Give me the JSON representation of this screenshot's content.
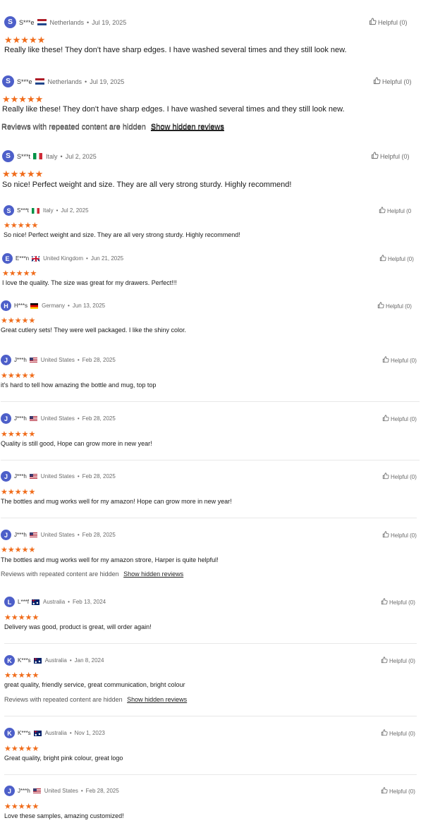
{
  "helpful_label": "Helpful",
  "hidden_note": "Reviews with repeated content are hidden",
  "show_hidden_link": "Show hidden reviews",
  "star_color": "#f06c1b",
  "avatar_color": "#4d5fc9",
  "reviews": [
    {
      "initial": "S",
      "name": "S***e",
      "flag": "nl",
      "country": "Netherlands",
      "date": "Jul 19, 2025",
      "rating": 5,
      "stars": "★★★★★",
      "text": "Really like these! They don't have sharp edges. I have washed several times and they still look new.",
      "helpful": "(0)",
      "helpful_icon": "thumbs-up-icon"
    },
    {
      "initial": "S",
      "name": "S***e",
      "flag": "nl",
      "country": "Netherlands",
      "date": "Jul 19, 2025",
      "rating": 5,
      "stars": "★★★★★",
      "text": "Really like these! They don't have sharp edges. I have washed several times and they still look new.",
      "helpful": "(0)",
      "helpful_icon": "thumbs-up-icon"
    },
    {
      "initial": "S",
      "name": "S***t",
      "flag": "it",
      "country": "Italy",
      "date": "Jul 2, 2025",
      "rating": 5,
      "stars": "★★★★★",
      "text": "So nice! Perfect weight and size. They are all very strong sturdy. Highly recommend!",
      "helpful": "(0)",
      "helpful_icon": "thumbs-up-icon"
    },
    {
      "initial": "S",
      "name": "S***t",
      "flag": "it",
      "country": "Italy",
      "date": "Jul 2, 2025",
      "rating": 5,
      "stars": "★★★★★",
      "text": "So nice! Perfect weight and size. They are all very strong sturdy. Highly recommend!",
      "helpful": "(0",
      "helpful_icon": "thumbs-up-icon"
    },
    {
      "initial": "E",
      "name": "E***n",
      "flag": "uk",
      "country": "United Kingdom",
      "date": "Jun 21, 2025",
      "rating": 5,
      "stars": "★★★★★",
      "text": "I love the quality. The size was great for my drawers. Perfect!!!",
      "helpful": "(0)",
      "helpful_icon": "thumbs-up-icon"
    },
    {
      "initial": "H",
      "name": "H***s",
      "flag": "de",
      "country": "Germany",
      "date": "Jun 13, 2025",
      "rating": 5,
      "stars": "★★★★★",
      "text": "Great cutlery sets! They were well packaged. I like the shiny color.",
      "helpful": "(0)",
      "helpful_icon": "thumbs-up-icon"
    },
    {
      "initial": "J",
      "name": "J***h",
      "flag": "us",
      "country": "United States",
      "date": "Feb 28, 2025",
      "rating": 5,
      "stars": "★★★★★",
      "text": "it's hard to tell how amazing the bottle and mug, top top",
      "helpful": "(0)",
      "helpful_icon": "thumbs-up-icon"
    },
    {
      "initial": "J",
      "name": "J***h",
      "flag": "us",
      "country": "United States",
      "date": "Feb 28, 2025",
      "rating": 5,
      "stars": "★★★★★",
      "text": "Quality is still good, Hope can grow more in new year!",
      "helpful": "(0)",
      "helpful_icon": "thumbs-up-icon"
    },
    {
      "initial": "J",
      "name": "J***h",
      "flag": "us",
      "country": "United States",
      "date": "Feb 28, 2025",
      "rating": 5,
      "stars": "★★★★★",
      "text": "The bottles and mug works well for my amazon! Hope can grow more in new year!",
      "helpful": "(0)",
      "helpful_icon": "thumbs-up-icon"
    },
    {
      "initial": "J",
      "name": "J***h",
      "flag": "us",
      "country": "United States",
      "date": "Feb 28, 2025",
      "rating": 5,
      "stars": "★★★★★",
      "text": "The bottles and mug works well for my amazon strore, Harper is quite helpful!",
      "helpful": "(0)",
      "helpful_icon": "thumbs-up-icon"
    },
    {
      "initial": "L",
      "name": "L***f",
      "flag": "au",
      "country": "Australia",
      "date": "Feb 13, 2024",
      "rating": 5,
      "stars": "★★★★★",
      "text": "Delivery was good, product is great, will order again!",
      "helpful": "(0)",
      "helpful_icon": "thumbs-up-icon"
    },
    {
      "initial": "K",
      "name": "K***s",
      "flag": "au",
      "country": "Australia",
      "date": "Jan 8, 2024",
      "rating": 5,
      "stars": "★★★★★",
      "text": "great quality, friendly service, great communication, bright colour",
      "helpful": "(0)",
      "helpful_icon": "thumbs-up-icon"
    },
    {
      "initial": "K",
      "name": "K***s",
      "flag": "au",
      "country": "Australia",
      "date": "Nov 1, 2023",
      "rating": 5,
      "stars": "★★★★★",
      "text": "Great quality, bright pink colour, great logo",
      "helpful": "(0)",
      "helpful_icon": "thumbs-up-icon"
    },
    {
      "initial": "J",
      "name": "J***h",
      "flag": "us",
      "country": "United States",
      "date": "Feb 28, 2025",
      "rating": 5,
      "stars": "★★★★★",
      "text": "Love these samples, amazing customized!",
      "helpful": "(0)",
      "helpful_icon": "thumbs-up-icon"
    }
  ]
}
